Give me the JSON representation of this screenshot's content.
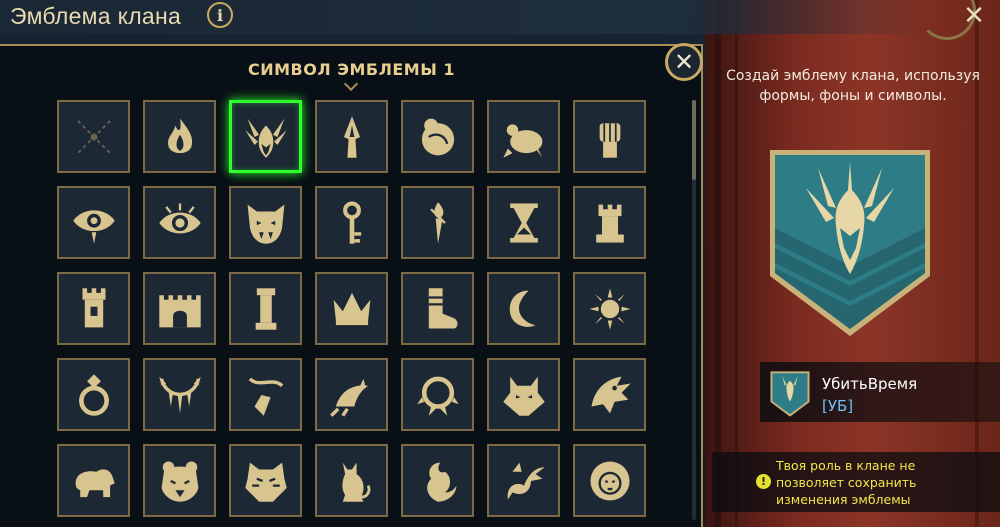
{
  "header": {
    "title": "Эмблема клана",
    "info_label": "i",
    "close_label": "✕"
  },
  "modal": {
    "title": "СИМВОЛ ЭМБЛЕМЫ 1",
    "close_label": "✕",
    "selected_index": 2
  },
  "symbols": [
    "none-icon",
    "flame-icon",
    "winged-helm-icon",
    "spearhead-icon",
    "fist-rose-icon",
    "roast-bird-icon",
    "raised-fist-icon",
    "weeping-eye-icon",
    "eye-icon",
    "fanged-mask-icon",
    "key-icon",
    "torch-icon",
    "hourglass-icon",
    "rook-icon",
    "tower-icon",
    "castle-gate-icon",
    "pillar-icon",
    "crown-icon",
    "boot-icon",
    "crescent-moon-icon",
    "sun-icon",
    "diamond-ring-icon",
    "tooth-necklace-icon",
    "amulet-icon",
    "claw-icon",
    "spiked-collar-icon",
    "wolf-head-icon",
    "dragon-head-icon",
    "bear-icon",
    "bear-head-icon",
    "tiger-head-icon",
    "cat-icon",
    "phoenix-icon",
    "serpent-dragon-icon",
    "lion-head-icon"
  ],
  "panel": {
    "hint": "Создай эмблему клана, используя формы, фоны и символы.",
    "clan_name": "УбитьВремя",
    "clan_tag": "[УБ]",
    "warning": "Твоя роль в клане не позволяет сохранить изменения эмблемы",
    "warning_icon": "!"
  },
  "colors": {
    "gold": "#c9a962",
    "selected": "#2dff2d",
    "banner": "#2f7f87",
    "warning": "#f0e84a",
    "tag": "#6ec4ff"
  }
}
